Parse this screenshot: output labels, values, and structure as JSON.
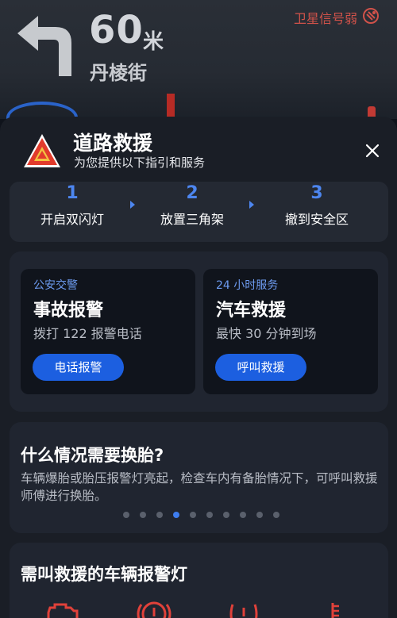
{
  "nav": {
    "distance": "60",
    "unit": "米",
    "street": "丹棱街",
    "gps_status": "卫星信号弱",
    "turn_icon": "turn-left-arrow-icon"
  },
  "rescue": {
    "title": "道路救援",
    "subtitle": "为您提供以下指引和服务",
    "steps": [
      {
        "num": "1",
        "label": "开启双闪灯"
      },
      {
        "num": "2",
        "label": "放置三角架"
      },
      {
        "num": "3",
        "label": "撤到安全区"
      }
    ],
    "services": [
      {
        "tag": "公安交警",
        "title": "事故报警",
        "desc": "拨打 122 报警电话",
        "button": "电话报警"
      },
      {
        "tag": "24 小时服务",
        "title": "汽车救援",
        "desc": "最快 30 分钟到场",
        "button": "呼叫救援"
      }
    ],
    "tip": {
      "question": "什么情况需要换胎?",
      "answer": "车辆爆胎或胎压报警灯亮起，检查车内有备胎情况下，可呼叫救援师傅进行换胎。",
      "page_count": 10,
      "active_page": 3
    },
    "lights_title": "需叫救援的车辆报警灯",
    "light_icons": [
      "engine-warning-icon",
      "brake-warning-icon",
      "tire-pressure-icon",
      "coolant-temperature-icon"
    ]
  },
  "colors": {
    "accent": "#1c5fe0",
    "step_number": "#4d86f0",
    "warning_red": "#d0524a",
    "light_icon_red": "#e0413a"
  }
}
